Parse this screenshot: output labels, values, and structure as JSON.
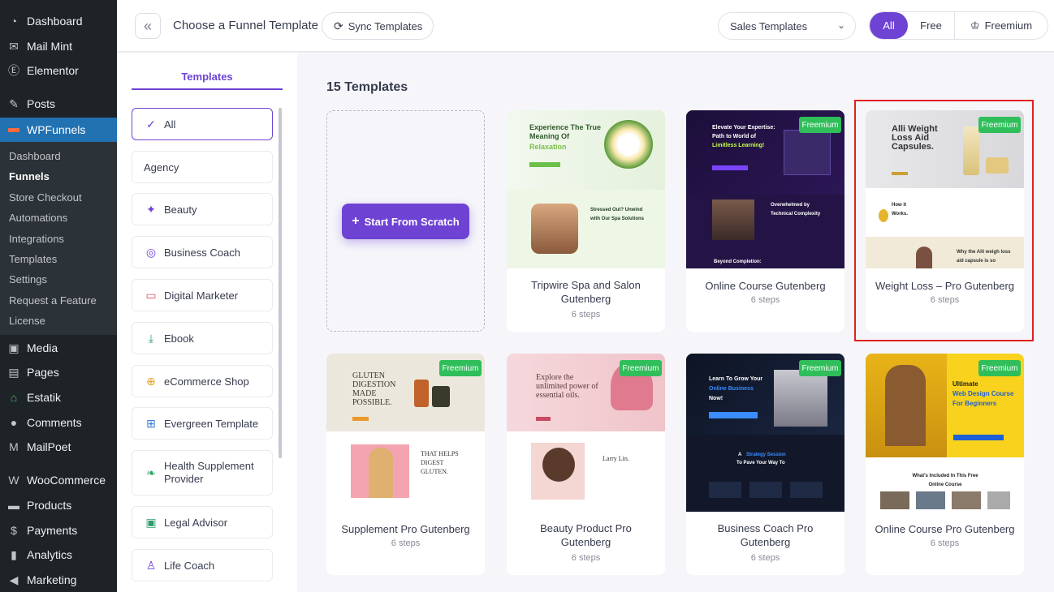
{
  "admin_menu": {
    "items": [
      {
        "label": "Dashboard",
        "icon": "dashboard-icon"
      },
      {
        "label": "Mail Mint",
        "icon": "mail-icon"
      },
      {
        "label": "Elementor",
        "icon": "elementor-icon"
      },
      {
        "label": "Posts",
        "icon": "pin-icon"
      },
      {
        "label": "WPFunnels",
        "icon": "funnel-icon"
      },
      {
        "label": "Media",
        "icon": "media-icon"
      },
      {
        "label": "Pages",
        "icon": "pages-icon"
      },
      {
        "label": "Estatik",
        "icon": "house-icon"
      },
      {
        "label": "Comments",
        "icon": "comment-icon"
      },
      {
        "label": "MailPoet",
        "icon": "mailpoet-icon"
      },
      {
        "label": "WooCommerce",
        "icon": "woo-icon"
      },
      {
        "label": "Products",
        "icon": "box-icon"
      },
      {
        "label": "Payments",
        "icon": "dollar-icon"
      },
      {
        "label": "Analytics",
        "icon": "bar-chart-icon"
      },
      {
        "label": "Marketing",
        "icon": "megaphone-icon"
      }
    ],
    "submenu": [
      "Dashboard",
      "Funnels",
      "Store Checkout",
      "Automations",
      "Integrations",
      "Templates",
      "Settings",
      "Request a Feature",
      "License"
    ]
  },
  "header": {
    "title": "Choose a Funnel Template",
    "sync_label": "Sync Templates",
    "category_select": "Sales Templates",
    "filters": {
      "all": "All",
      "free": "Free",
      "freemium": "Freemium"
    }
  },
  "categories": {
    "heading": "Templates",
    "items": [
      "All",
      "Agency",
      "Beauty",
      "Business Coach",
      "Digital Marketer",
      "Ebook",
      "eCommerce Shop",
      "Evergreen Template",
      "Health Supplement Provider",
      "Legal Advisor",
      "Life Coach"
    ]
  },
  "main": {
    "count_label": "15 Templates",
    "scratch_label": "Start From Scratch",
    "badge": "Freemium",
    "templates": [
      {
        "title": "Tripwire Spa and Salon Gutenberg",
        "steps": "6 steps"
      },
      {
        "title": "Online Course Gutenberg",
        "steps": "6 steps"
      },
      {
        "title": "Weight Loss – Pro Gutenberg",
        "steps": "6 steps"
      },
      {
        "title": "Supplement Pro Gutenberg",
        "steps": "6 steps"
      },
      {
        "title": "Beauty Product Pro Gutenberg",
        "steps": "6 steps"
      },
      {
        "title": "Business Coach Pro Gutenberg",
        "steps": "6 steps"
      },
      {
        "title": "Online Course Pro Gutenberg",
        "steps": "6 steps"
      }
    ]
  },
  "thumbs": {
    "spa_head": "Experience The True Meaning Of",
    "spa_head2": "Relaxation",
    "spa_sub": "Stressed Out? Unwind with Our Spa Solutions",
    "course_head": "Elevate Your Expertise: Path to World of",
    "course_head2": "Limitless Learning!",
    "course_sub": "Overwhelmed by Technical Complexity",
    "course_sub2": "Beyond Completion:",
    "weight_head": "Alli Weight Loss Aid Capsules.",
    "weight_sub": "How it Works.",
    "weight_sub2": "Why the Alli weigh loss aid capsule is so",
    "supp_head": "GLUTEN DIGESTION MADE POSSIBLE.",
    "supp_sub": "THAT HELPS DIGEST GLUTEN.",
    "beauty_head": "Explore the unlimited power of essential oils.",
    "beauty_sub": "Larry Lin.",
    "coach_head": "Learn To Grow Your",
    "coach_head2": "Online Business",
    "coach_head3": "Now!",
    "coach_sub": "A",
    "coach_sub2": "Strategy Session",
    "coach_sub3": "To Pave Your Way To",
    "oc_head": "Ultimate",
    "oc_head2": "Web Design Course",
    "oc_head3": "For Beginners",
    "oc_sub": "What's Included In This Free Online Course"
  }
}
